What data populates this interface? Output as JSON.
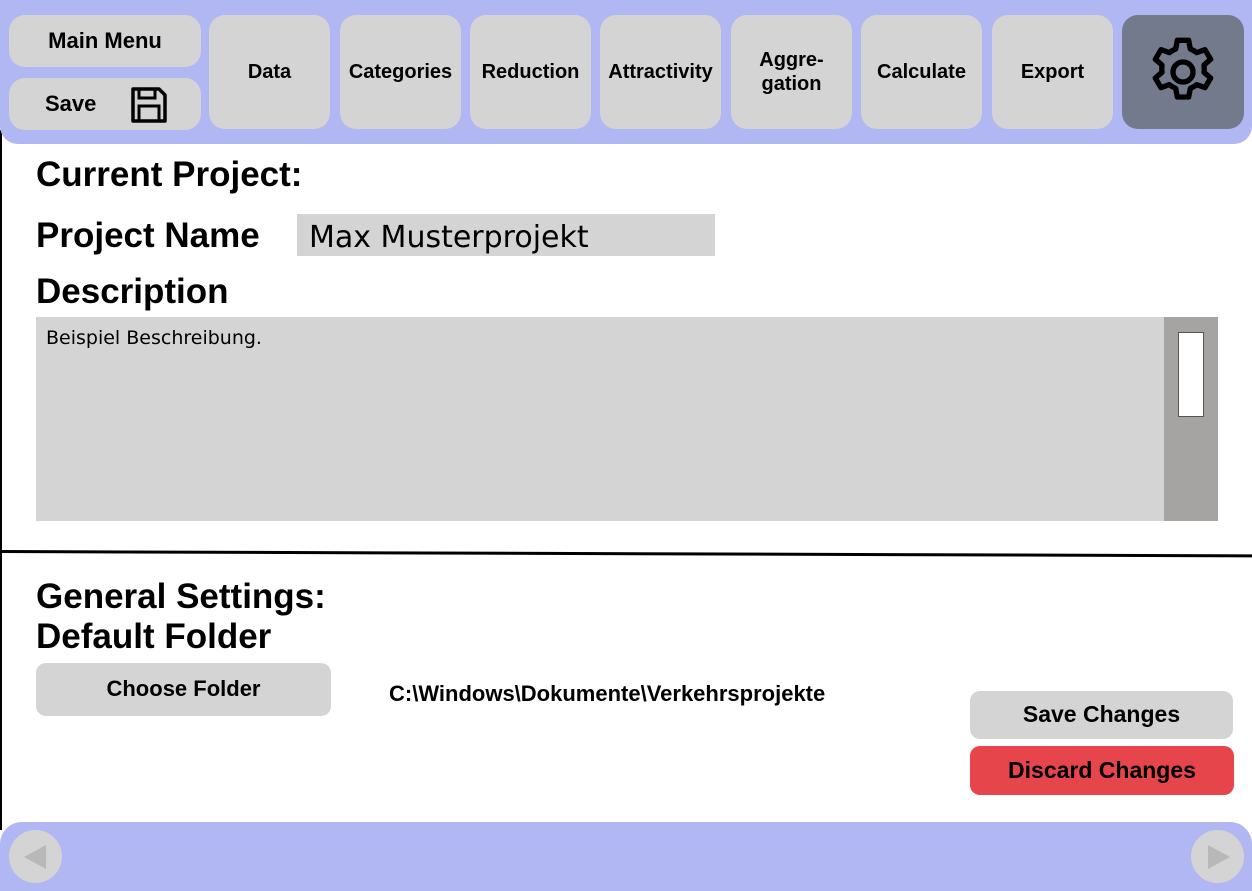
{
  "toolbar": {
    "main_menu_label": "Main Menu",
    "save_label": "Save",
    "tabs": [
      {
        "label": "Data"
      },
      {
        "label": "Categories"
      },
      {
        "label": "Reduction"
      },
      {
        "label": "Attractivity"
      },
      {
        "label": "Aggre-\ngation"
      },
      {
        "label": "Calculate"
      },
      {
        "label": "Export"
      }
    ],
    "settings_icon": "gear-icon",
    "save_icon": "floppy-disk-icon"
  },
  "project": {
    "heading": "Current Project:",
    "name_label": "Project Name",
    "name_value": "Max Musterprojekt",
    "description_label": "Description",
    "description_value": "Beispiel Beschreibung."
  },
  "general": {
    "heading": "General Settings:",
    "folder_label": "Default Folder",
    "choose_folder_label": "Choose Folder",
    "folder_path": "C:\\Windows\\Dokumente\\Verkehrsprojekte",
    "save_changes_label": "Save Changes",
    "discard_changes_label": "Discard Changes"
  },
  "colors": {
    "bar": "#b0b7f2",
    "button": "#d4d4d4",
    "settings_active": "#737a8c",
    "discard": "#e6464b",
    "scrollbar": "#a6a3a3"
  },
  "navigation": {
    "prev_icon": "triangle-left-icon",
    "next_icon": "triangle-right-icon"
  }
}
